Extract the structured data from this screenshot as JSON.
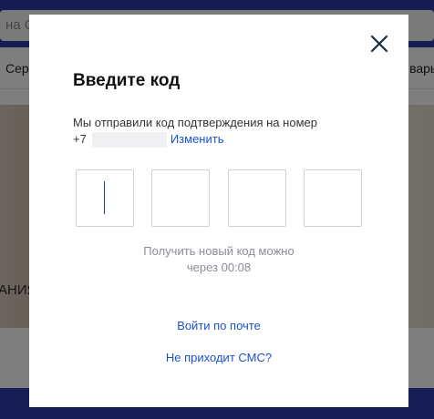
{
  "background": {
    "search_text": "на С",
    "nav_left": "Серв",
    "nav_right": "вары",
    "banner_text": "АНИЯ."
  },
  "modal": {
    "title": "Введите код",
    "info_text": "Мы отправили код подтверждения на номер",
    "phone_prefix": "+7",
    "change_link": "Изменить",
    "code_digits": [
      "",
      "",
      "",
      ""
    ],
    "resend_line1": "Получить новый код можно",
    "resend_line2": "через 00:08",
    "email_login_link": "Войти по почте",
    "sms_help_link": "Не приходит СМС?"
  },
  "colors": {
    "accent": "#1a50d8",
    "header_bg": "#2c3aa7",
    "muted_text": "#8c8c96"
  },
  "icons": {
    "close": "close-icon"
  }
}
